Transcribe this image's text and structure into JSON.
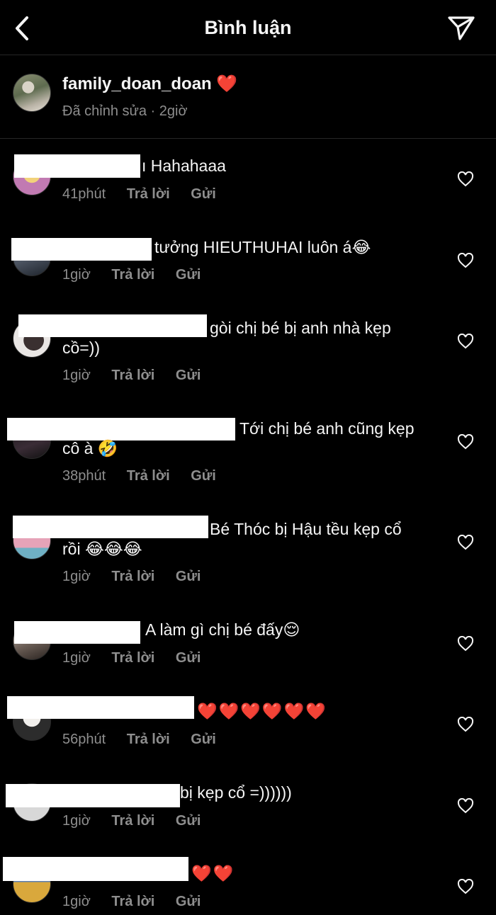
{
  "header": {
    "title": "Bình luận"
  },
  "caption": {
    "username": "family_doan_doan",
    "emoji": "❤️",
    "meta": "Đã chỉnh sửa · 2giờ"
  },
  "actions": {
    "reply": "Trả lời",
    "send": "Gửi"
  },
  "comments": [
    {
      "text": "ı Hahahaaa",
      "time": "41phút"
    },
    {
      "text": "tưởng HIEUTHUHAI luôn á😂",
      "time": "1giờ"
    },
    {
      "text": "gòi chị bé bị anh nhà kẹp\ncồ=))",
      "time": "1giờ"
    },
    {
      "text": "Tới chị bé anh cũng kẹp\ncô à 🤣",
      "time": "38phút"
    },
    {
      "text": "Bé Thóc bị Hậu tều kẹp cổ\nrồi 😂😂😂",
      "time": "1giờ"
    },
    {
      "text": "A làm gì chị bé đấy😌",
      "time": "1giờ"
    },
    {
      "text": "❤️❤️❤️❤️❤️❤️",
      "time": "56phút"
    },
    {
      "text": "bị kẹp cổ =))))))",
      "time": "1giờ"
    },
    {
      "text": "❤️❤️",
      "time": "1giờ"
    }
  ],
  "colors": {
    "background": "#000000",
    "text": "#f5f5f5",
    "muted": "#8e8e8e",
    "divider": "#262626"
  },
  "icons": {
    "back": "chevron-left-icon",
    "send": "paper-plane-icon",
    "like": "heart-outline-icon"
  }
}
